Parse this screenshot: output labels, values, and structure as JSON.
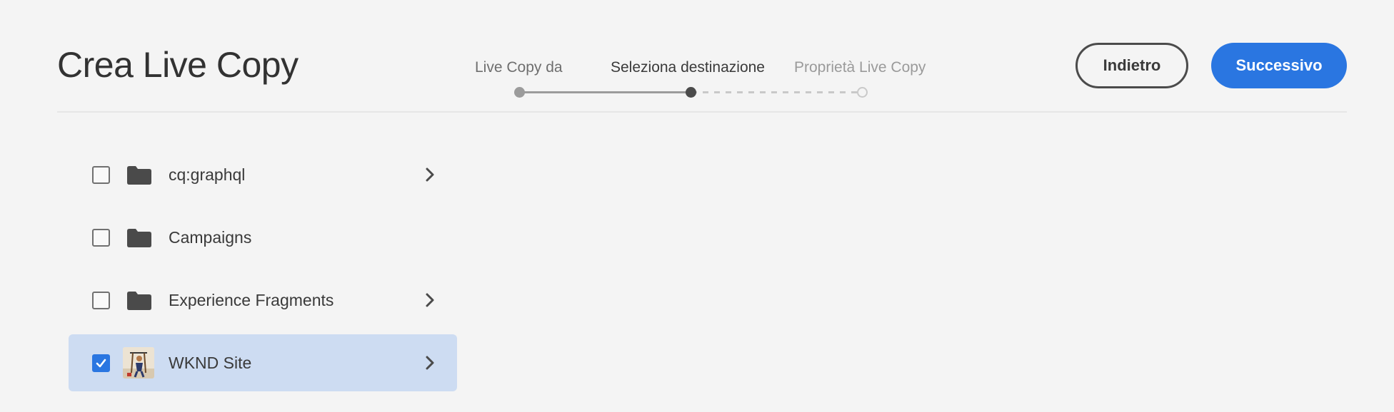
{
  "header": {
    "title": "Crea Live Copy",
    "back_label": "Indietro",
    "next_label": "Successivo"
  },
  "stepper": {
    "steps": [
      {
        "label": "Live Copy da",
        "state": "done"
      },
      {
        "label": "Seleziona destinazione",
        "state": "active"
      },
      {
        "label": "Proprietà Live Copy",
        "state": "future"
      }
    ]
  },
  "list": {
    "items": [
      {
        "label": "cq:graphql",
        "icon": "folder-icon",
        "checked": false,
        "has_children": true
      },
      {
        "label": "Campaigns",
        "icon": "folder-icon",
        "checked": false,
        "has_children": false
      },
      {
        "label": "Experience Fragments",
        "icon": "folder-icon",
        "checked": false,
        "has_children": true
      },
      {
        "label": "WKND Site",
        "icon": "site-thumbnail",
        "checked": true,
        "has_children": true
      }
    ]
  },
  "colors": {
    "accent": "#2a76e1",
    "selected_row": "#cddcf2",
    "background": "#f4f4f4"
  }
}
